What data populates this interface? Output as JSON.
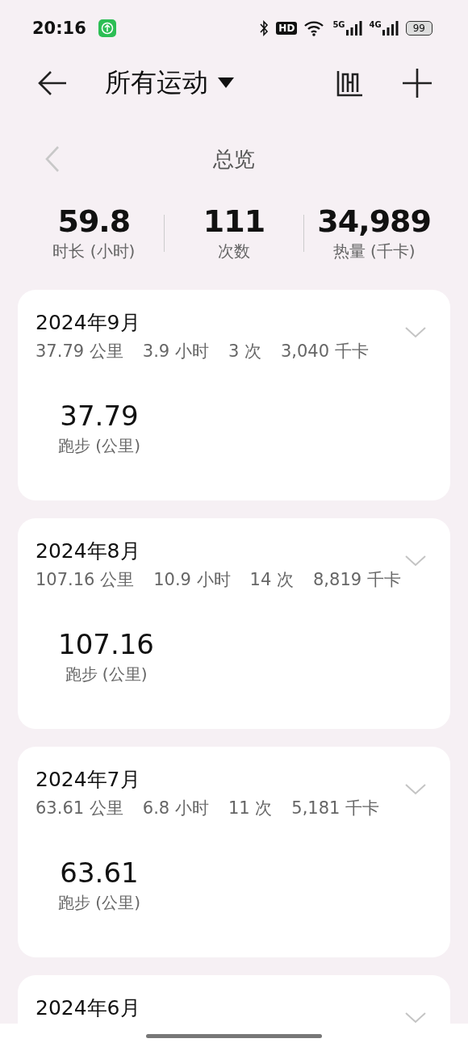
{
  "status_bar": {
    "time": "20:16",
    "hd": "HD",
    "networks": [
      "5G",
      "4G"
    ],
    "battery": "99"
  },
  "header": {
    "title": "所有运动"
  },
  "overview": {
    "title": "总览",
    "stats": [
      {
        "value": "59.8",
        "label": "时长 (小时)"
      },
      {
        "value": "111",
        "label": "次数"
      },
      {
        "value": "34,989",
        "label": "热量 (千卡)"
      }
    ]
  },
  "months": [
    {
      "title": "2024年9月",
      "summary": [
        "37.79 公里",
        "3.9 小时",
        "3 次",
        "3,040 千卡"
      ],
      "sports": [
        {
          "value": "37.79",
          "label": "跑步 (公里)"
        }
      ]
    },
    {
      "title": "2024年8月",
      "summary": [
        "107.16 公里",
        "10.9 小时",
        "14 次",
        "8,819 千卡"
      ],
      "sports": [
        {
          "value": "107.16",
          "label": "跑步 (公里)"
        }
      ]
    },
    {
      "title": "2024年7月",
      "summary": [
        "63.61 公里",
        "6.8 小时",
        "11 次",
        "5,181 千卡"
      ],
      "sports": [
        {
          "value": "63.61",
          "label": "跑步 (公里)"
        }
      ]
    },
    {
      "title": "2024年6月"
    }
  ]
}
